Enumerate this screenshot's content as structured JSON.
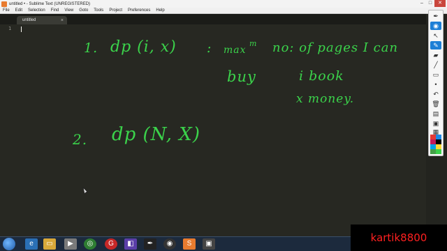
{
  "window": {
    "title": "untitled • - Sublime Text (UNREGISTERED)",
    "minimize": "–",
    "maximize": "□",
    "close": "✕"
  },
  "menu": [
    "File",
    "Edit",
    "Selection",
    "Find",
    "View",
    "Goto",
    "Tools",
    "Project",
    "Preferences",
    "Help"
  ],
  "tab": {
    "label": "untitled",
    "close": "×"
  },
  "editor": {
    "line_number": "1"
  },
  "notes": {
    "l1_num": "1.",
    "l1_expr": "dp (i, x)",
    "l1_colon": ":",
    "l1_max": "max",
    "l1_m": "m",
    "l1_rest": "no: of pages I can",
    "l2_buy": "buy",
    "l2_book": "i book",
    "l3_money": "x money.",
    "l4_num": "2.",
    "l4_expr": "dp (N, X)"
  },
  "watermark": {
    "text": "kartik8800"
  },
  "colors": {
    "ink": "#3bd34b",
    "editor_bg": "#272822",
    "watermark_text": "#ff2020"
  }
}
